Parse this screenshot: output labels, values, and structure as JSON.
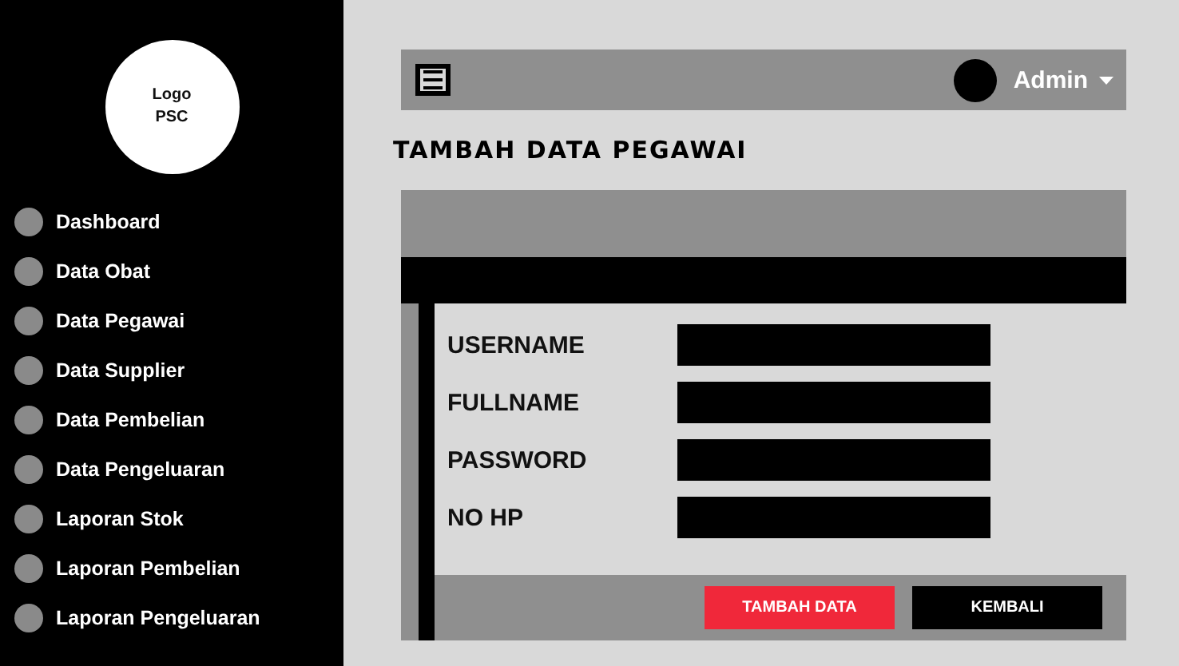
{
  "sidebar": {
    "logo": [
      "Logo",
      "PSC"
    ],
    "items": [
      {
        "label": "Dashboard"
      },
      {
        "label": "Data Obat"
      },
      {
        "label": "Data Pegawai"
      },
      {
        "label": "Data Supplier"
      },
      {
        "label": "Data Pembelian"
      },
      {
        "label": "Data Pengeluaran"
      },
      {
        "label": "Laporan Stok"
      },
      {
        "label": "Laporan Pembelian"
      },
      {
        "label": "Laporan Pengeluaran"
      }
    ]
  },
  "topbar": {
    "user": "Admin"
  },
  "page_title": "TAMBAH DATA PEGAWAI",
  "form": {
    "fields": [
      {
        "label": "USERNAME"
      },
      {
        "label": "FULLNAME"
      },
      {
        "label": "PASSWORD"
      },
      {
        "label": "NO HP"
      }
    ],
    "buttons": [
      {
        "label": "TAMBAH DATA",
        "kind": "primary"
      },
      {
        "label": "KEMBALI",
        "kind": "secondary"
      }
    ]
  }
}
